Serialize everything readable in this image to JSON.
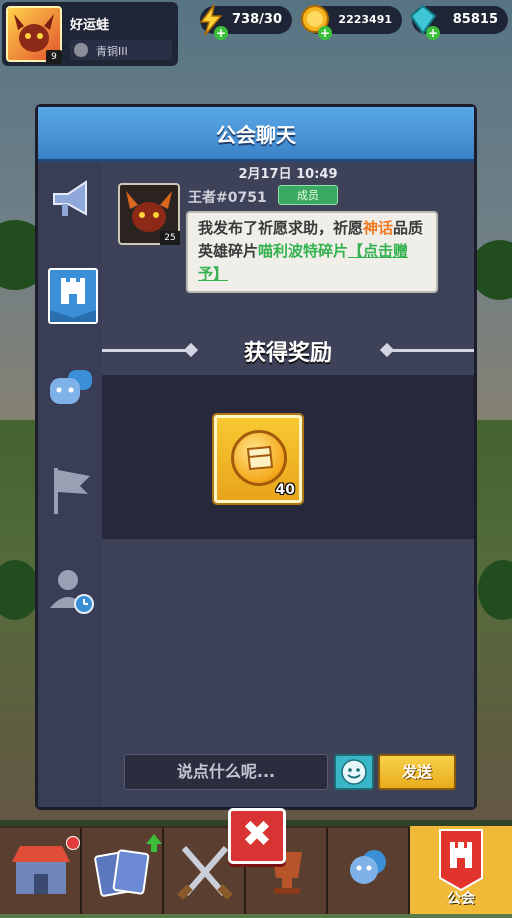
{
  "hud": {
    "player_name": "好运蛙",
    "avatar_level": "9",
    "rank": "青铜III",
    "energy": "738/30",
    "gold": "2223491",
    "gems": "85815"
  },
  "panel": {
    "title": "公会聊天"
  },
  "message": {
    "time": "2月17日 10:49",
    "sender": "王者#0751",
    "sender_level": "25",
    "role_badge": "成员",
    "text_parts": {
      "p1": "我发布了祈愿求助，祈愿",
      "p2": "神话",
      "p3": "品质英雄碎片",
      "p4": "喵利波特碎片",
      "p5": "【点击赠予】"
    }
  },
  "reward": {
    "title": "获得奖励",
    "item_count": "40"
  },
  "input": {
    "placeholder": "说点什么呢...",
    "send_label": "发送"
  },
  "close_label": "✖",
  "bottom_nav": {
    "guild_label": "公会"
  },
  "colors": {
    "accent_blue": "#3b82c7",
    "highlight_orange": "#f07a21",
    "highlight_green": "#33b24e",
    "send_yellow": "#f0b938",
    "close_red": "#d83434"
  },
  "icons": [
    "megaphone-icon",
    "castle-flag-icon",
    "chat-face-icon",
    "flag-icon",
    "user-clock-icon",
    "smiley-icon",
    "shop-icon",
    "cards-icon",
    "swords-icon",
    "trophy-icon",
    "friends-icon",
    "guild-icon"
  ]
}
